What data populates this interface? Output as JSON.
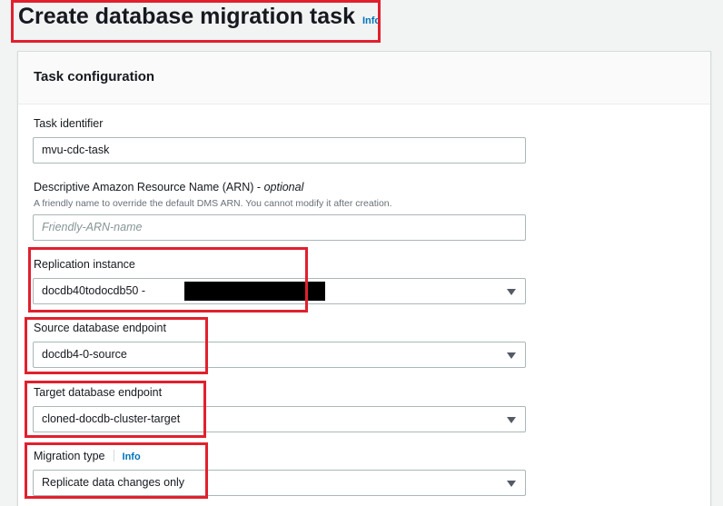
{
  "header": {
    "title": "Create database migration task",
    "info_label": "Info"
  },
  "panel": {
    "title": "Task configuration"
  },
  "task_identifier": {
    "label": "Task identifier",
    "value": "mvu-cdc-task"
  },
  "arn": {
    "label": "Descriptive Amazon Resource Name (ARN)",
    "label_sep": " - ",
    "optional": "optional",
    "description": "A friendly name to override the default DMS ARN. You cannot modify it after creation.",
    "placeholder": "Friendly-ARN-name"
  },
  "replication_instance": {
    "label": "Replication instance",
    "value": "docdb40todocdb50 -"
  },
  "source_endpoint": {
    "label": "Source database endpoint",
    "value": "docdb4-0-source"
  },
  "target_endpoint": {
    "label": "Target database endpoint",
    "value": "cloned-docdb-cluster-target"
  },
  "migration_type": {
    "label": "Migration type",
    "info_label": "Info",
    "value": "Replicate data changes only"
  },
  "colors": {
    "highlight": "#e1202d",
    "link": "#0073bb",
    "panel_header_bg": "#fafafa",
    "page_bg": "#f2f3f3"
  },
  "icons": {
    "dropdown": "caret-down-icon"
  }
}
